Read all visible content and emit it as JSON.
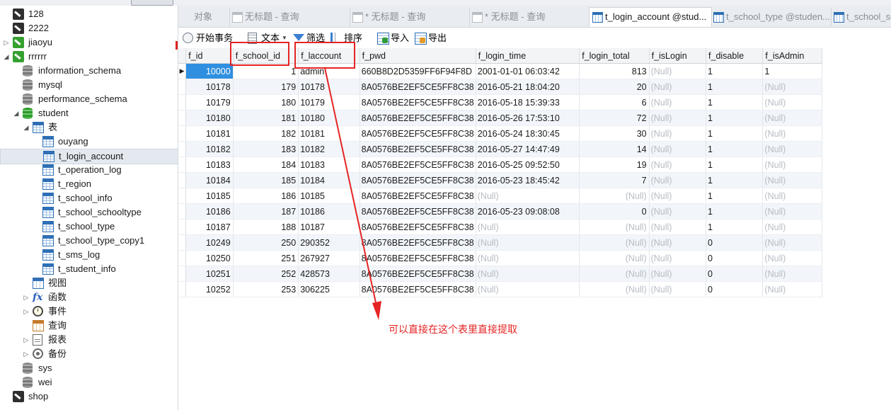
{
  "tabs": [
    {
      "label": "对象",
      "icon": "none",
      "active": false
    },
    {
      "label": "无标题 - 查询",
      "icon": "query-icon",
      "active": false
    },
    {
      "label": "* 无标题 - 查询",
      "icon": "query-icon",
      "active": false
    },
    {
      "label": "* 无标题 - 查询",
      "icon": "query-icon",
      "active": false
    },
    {
      "label": "t_login_account @stud...",
      "icon": "table-icon",
      "active": true
    },
    {
      "label": "t_school_type @studen...",
      "icon": "table-icon",
      "active": false
    },
    {
      "label": "t_school_sc",
      "icon": "table-icon",
      "active": false
    }
  ],
  "toolbar": {
    "begin_transaction": "开始事务",
    "text": "文本",
    "filter": "筛选",
    "sort": "排序",
    "import": "导入",
    "export": "导出"
  },
  "sidebar": {
    "items": [
      {
        "label": "128",
        "icon": "connection-icon"
      },
      {
        "label": "2222",
        "icon": "connection-icon"
      },
      {
        "label": "jiaoyu",
        "icon": "connection-green-icon",
        "toggle": "▷"
      },
      {
        "label": "rrrrrr",
        "icon": "connection-green-icon",
        "toggle": "◢"
      },
      {
        "label": "information_schema",
        "icon": "database-icon"
      },
      {
        "label": "mysql",
        "icon": "database-icon"
      },
      {
        "label": "performance_schema",
        "icon": "database-icon"
      },
      {
        "label": "student",
        "icon": "database-green-icon",
        "toggle": "◢"
      },
      {
        "label": "表",
        "icon": "table-folder-icon",
        "toggle": "◢"
      },
      {
        "label": "ouyang",
        "icon": "table-icon"
      },
      {
        "label": "t_login_account",
        "icon": "table-icon",
        "selected": true
      },
      {
        "label": "t_operation_log",
        "icon": "table-icon"
      },
      {
        "label": "t_region",
        "icon": "table-icon"
      },
      {
        "label": "t_school_info",
        "icon": "table-icon"
      },
      {
        "label": "t_school_schooltype",
        "icon": "table-icon"
      },
      {
        "label": "t_school_type",
        "icon": "table-icon"
      },
      {
        "label": "t_school_type_copy1",
        "icon": "table-icon"
      },
      {
        "label": "t_sms_log",
        "icon": "table-icon"
      },
      {
        "label": "t_student_info",
        "icon": "table-icon"
      },
      {
        "label": "视图",
        "icon": "view-icon"
      },
      {
        "label": "函数",
        "icon": "function-icon",
        "toggle": "▷"
      },
      {
        "label": "事件",
        "icon": "event-icon",
        "toggle": "▷"
      },
      {
        "label": "查询",
        "icon": "query-icon"
      },
      {
        "label": "报表",
        "icon": "report-icon",
        "toggle": "▷"
      },
      {
        "label": "备份",
        "icon": "backup-icon",
        "toggle": "▷"
      },
      {
        "label": "sys",
        "icon": "database-icon"
      },
      {
        "label": "wei",
        "icon": "database-icon"
      },
      {
        "label": "shop",
        "icon": "connection-icon"
      }
    ]
  },
  "grid": {
    "columns": [
      "f_id",
      "f_school_id",
      "f_laccount",
      "f_pwd",
      "f_login_time",
      "f_login_total",
      "f_isLogin",
      "f_disable",
      "f_isAdmin"
    ],
    "rows": [
      [
        "10000",
        "1",
        "admin",
        "660B8D2D5359FF6F94F8D",
        "2001-01-01 06:03:42",
        "813",
        "(Null)",
        "1",
        "1"
      ],
      [
        "10178",
        "179",
        "10178",
        "8A0576BE2EF5CE5FF8C38",
        "2016-05-21 18:04:20",
        "20",
        "(Null)",
        "1",
        "(Null)"
      ],
      [
        "10179",
        "180",
        "10179",
        "8A0576BE2EF5CE5FF8C38",
        "2016-05-18 15:39:33",
        "6",
        "(Null)",
        "1",
        "(Null)"
      ],
      [
        "10180",
        "181",
        "10180",
        "8A0576BE2EF5CE5FF8C38",
        "2016-05-26 17:53:10",
        "72",
        "(Null)",
        "1",
        "(Null)"
      ],
      [
        "10181",
        "182",
        "10181",
        "8A0576BE2EF5CE5FF8C38",
        "2016-05-24 18:30:45",
        "30",
        "(Null)",
        "1",
        "(Null)"
      ],
      [
        "10182",
        "183",
        "10182",
        "8A0576BE2EF5CE5FF8C38",
        "2016-05-27 14:47:49",
        "14",
        "(Null)",
        "1",
        "(Null)"
      ],
      [
        "10183",
        "184",
        "10183",
        "8A0576BE2EF5CE5FF8C38",
        "2016-05-25 09:52:50",
        "19",
        "(Null)",
        "1",
        "(Null)"
      ],
      [
        "10184",
        "185",
        "10184",
        "8A0576BE2EF5CE5FF8C38",
        "2016-05-23 18:45:42",
        "7",
        "(Null)",
        "1",
        "(Null)"
      ],
      [
        "10185",
        "186",
        "10185",
        "8A0576BE2EF5CE5FF8C38",
        "(Null)",
        "(Null)",
        "(Null)",
        "1",
        "(Null)"
      ],
      [
        "10186",
        "187",
        "10186",
        "8A0576BE2EF5CE5FF8C38",
        "2016-05-23 09:08:08",
        "0",
        "(Null)",
        "1",
        "(Null)"
      ],
      [
        "10187",
        "188",
        "10187",
        "8A0576BE2EF5CE5FF8C38",
        "(Null)",
        "(Null)",
        "(Null)",
        "1",
        "(Null)"
      ],
      [
        "10249",
        "250",
        "290352",
        "8A0576BE2EF5CE5FF8C38",
        "(Null)",
        "(Null)",
        "(Null)",
        "0",
        "(Null)"
      ],
      [
        "10250",
        "251",
        "267927",
        "8A0576BE2EF5CE5FF8C38",
        "(Null)",
        "(Null)",
        "(Null)",
        "0",
        "(Null)"
      ],
      [
        "10251",
        "252",
        "428573",
        "8A0576BE2EF5CE5FF8C38",
        "(Null)",
        "(Null)",
        "(Null)",
        "0",
        "(Null)"
      ],
      [
        "10252",
        "253",
        "306225",
        "8A0576BE2EF5CE5FF8C38",
        "(Null)",
        "(Null)",
        "(Null)",
        "0",
        "(Null)"
      ]
    ],
    "current_row_marker": "▶"
  },
  "annotation": {
    "text": "可以直接在这个表里直接提取",
    "color": "#e52424"
  },
  "colors": {
    "selection": "#2f8fe0",
    "null_text": "#b8bcc2",
    "highlight": "#e52424"
  }
}
